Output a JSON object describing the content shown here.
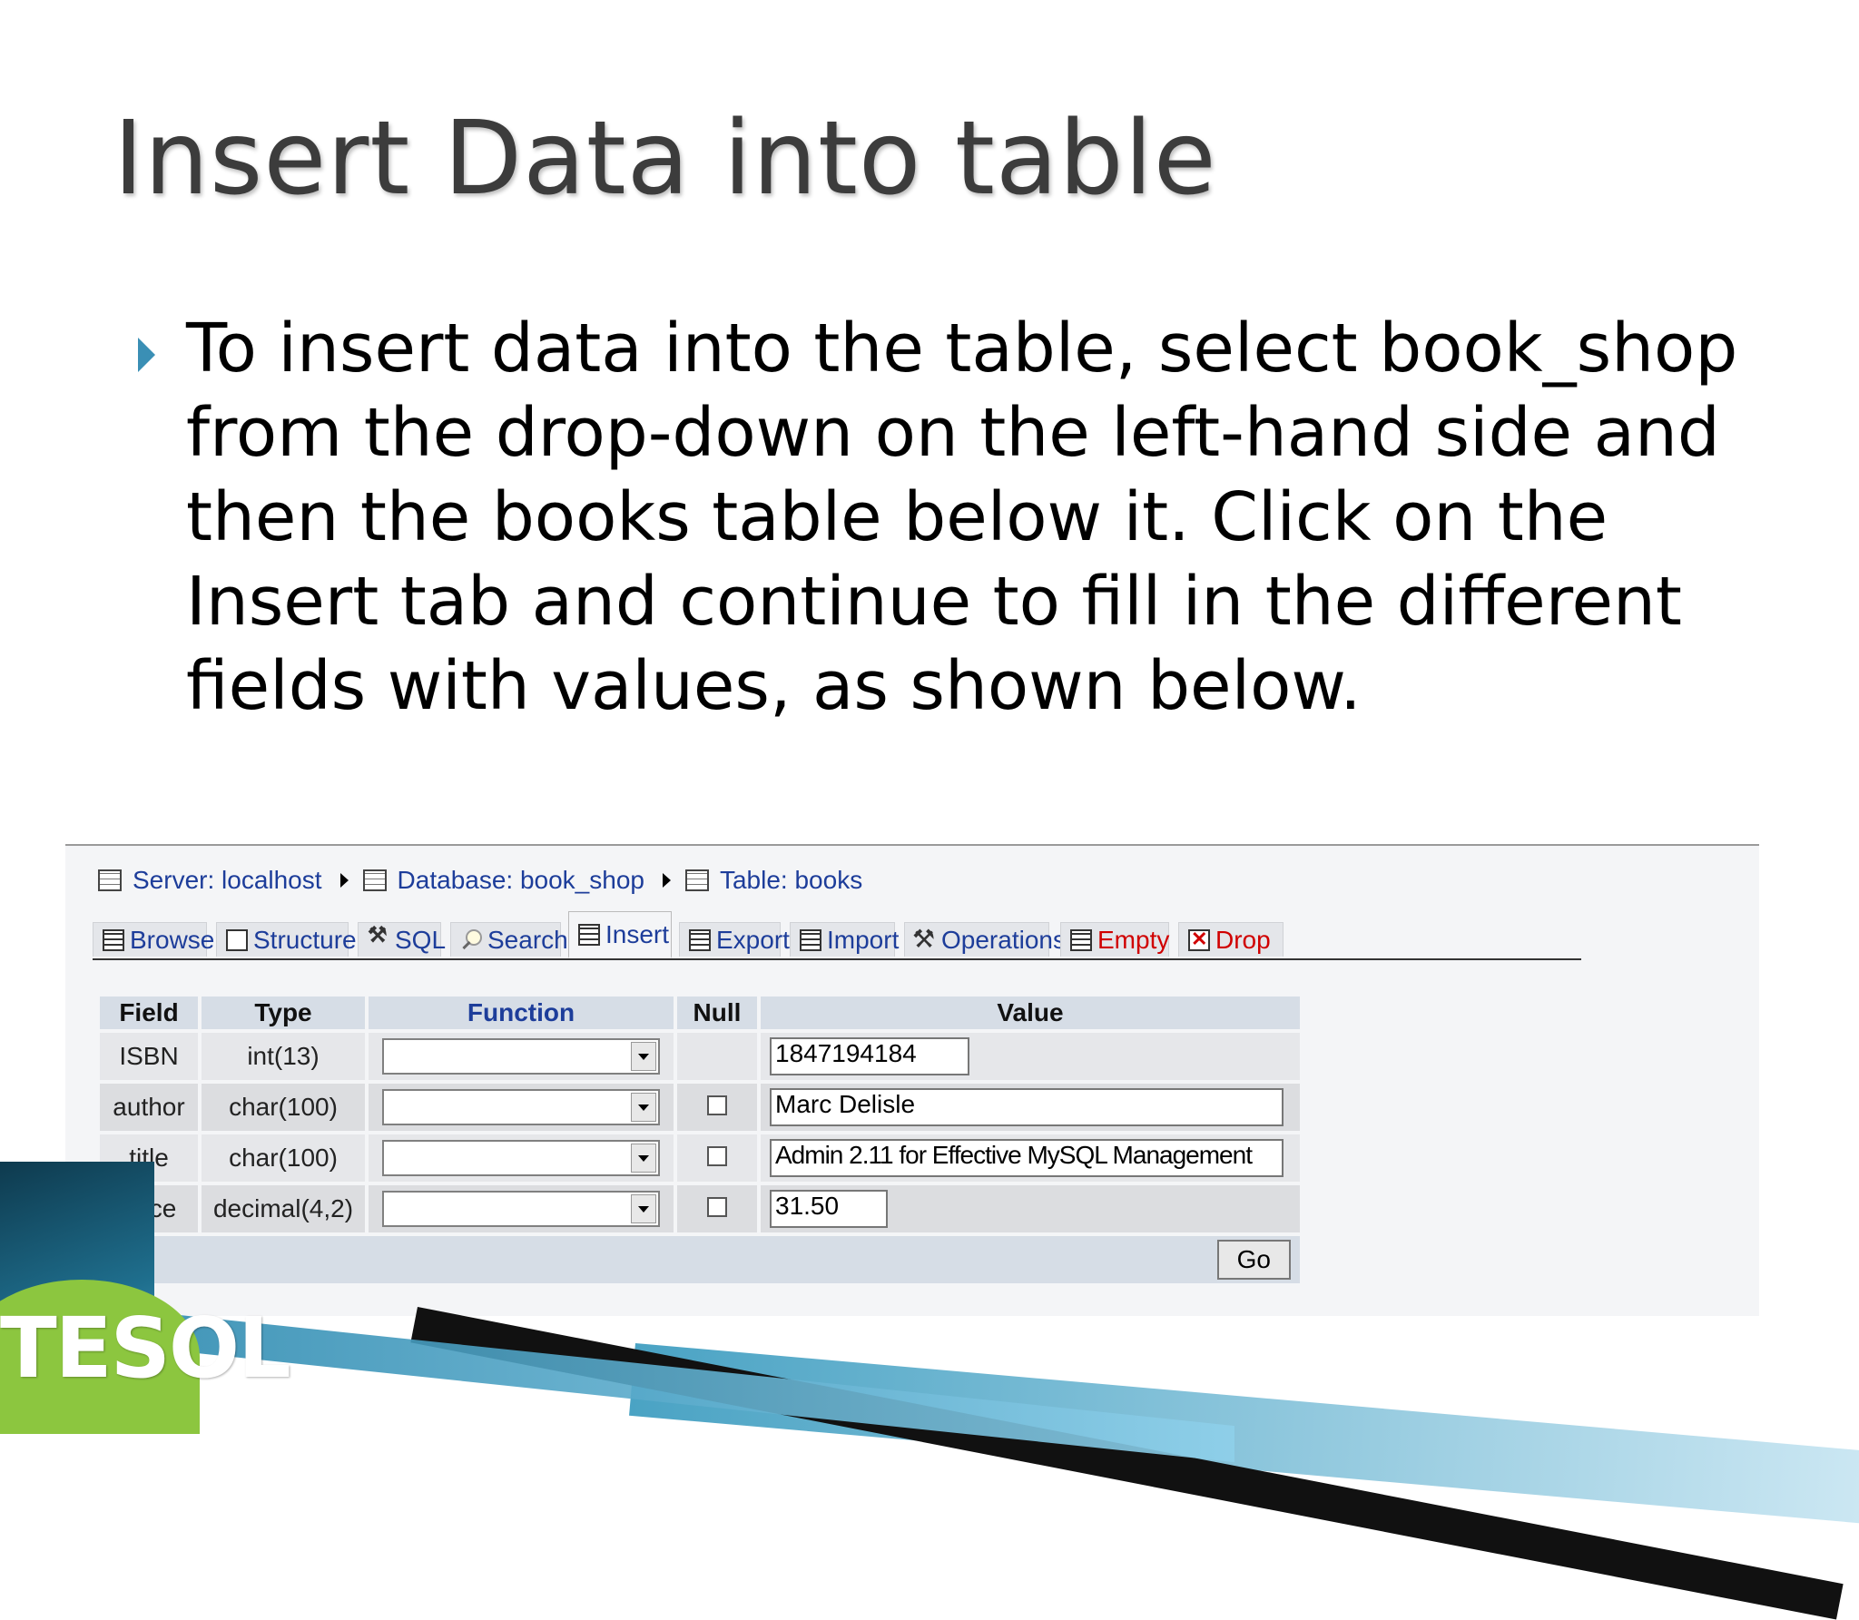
{
  "slide": {
    "title": "Insert Data into table",
    "bullet": "To insert data into the table, select book_shop from the drop-down on the left-hand side and then the books table below it. Click on the Insert tab and continue to fill in the different fields with values, as shown below.",
    "logo_text": "TESOL"
  },
  "breadcrumb": {
    "server": "Server: localhost",
    "database": "Database: book_shop",
    "table": "Table: books"
  },
  "tabs": [
    {
      "label": "Browse",
      "icon": "browse-icon"
    },
    {
      "label": "Structure",
      "icon": "structure-icon"
    },
    {
      "label": "SQL",
      "icon": "sql-icon"
    },
    {
      "label": "Search",
      "icon": "search-icon"
    },
    {
      "label": "Insert",
      "icon": "insert-icon",
      "active": true
    },
    {
      "label": "Export",
      "icon": "export-icon"
    },
    {
      "label": "Import",
      "icon": "import-icon"
    },
    {
      "label": "Operations",
      "icon": "operations-icon"
    },
    {
      "label": "Empty",
      "icon": "empty-icon"
    },
    {
      "label": "Drop",
      "icon": "drop-icon"
    }
  ],
  "form": {
    "headers": {
      "field": "Field",
      "type": "Type",
      "function": "Function",
      "null": "Null",
      "value": "Value"
    },
    "rows": [
      {
        "field": "ISBN",
        "type": "int(13)",
        "function": "",
        "has_null": false,
        "value": "1847194184"
      },
      {
        "field": "author",
        "type": "char(100)",
        "function": "",
        "has_null": true,
        "value": "Marc Delisle"
      },
      {
        "field": "title",
        "type": "char(100)",
        "function": "",
        "has_null": true,
        "value": "Admin 2.11 for Effective MySQL Management"
      },
      {
        "field": "price",
        "type": "decimal(4,2)",
        "function": "",
        "has_null": true,
        "value": "31.50"
      }
    ],
    "go_label": "Go"
  },
  "colors": {
    "link": "#1d3d9a",
    "danger": "#d00000",
    "header_bg": "#d6dde6",
    "bullet": "#3a8fb5"
  }
}
